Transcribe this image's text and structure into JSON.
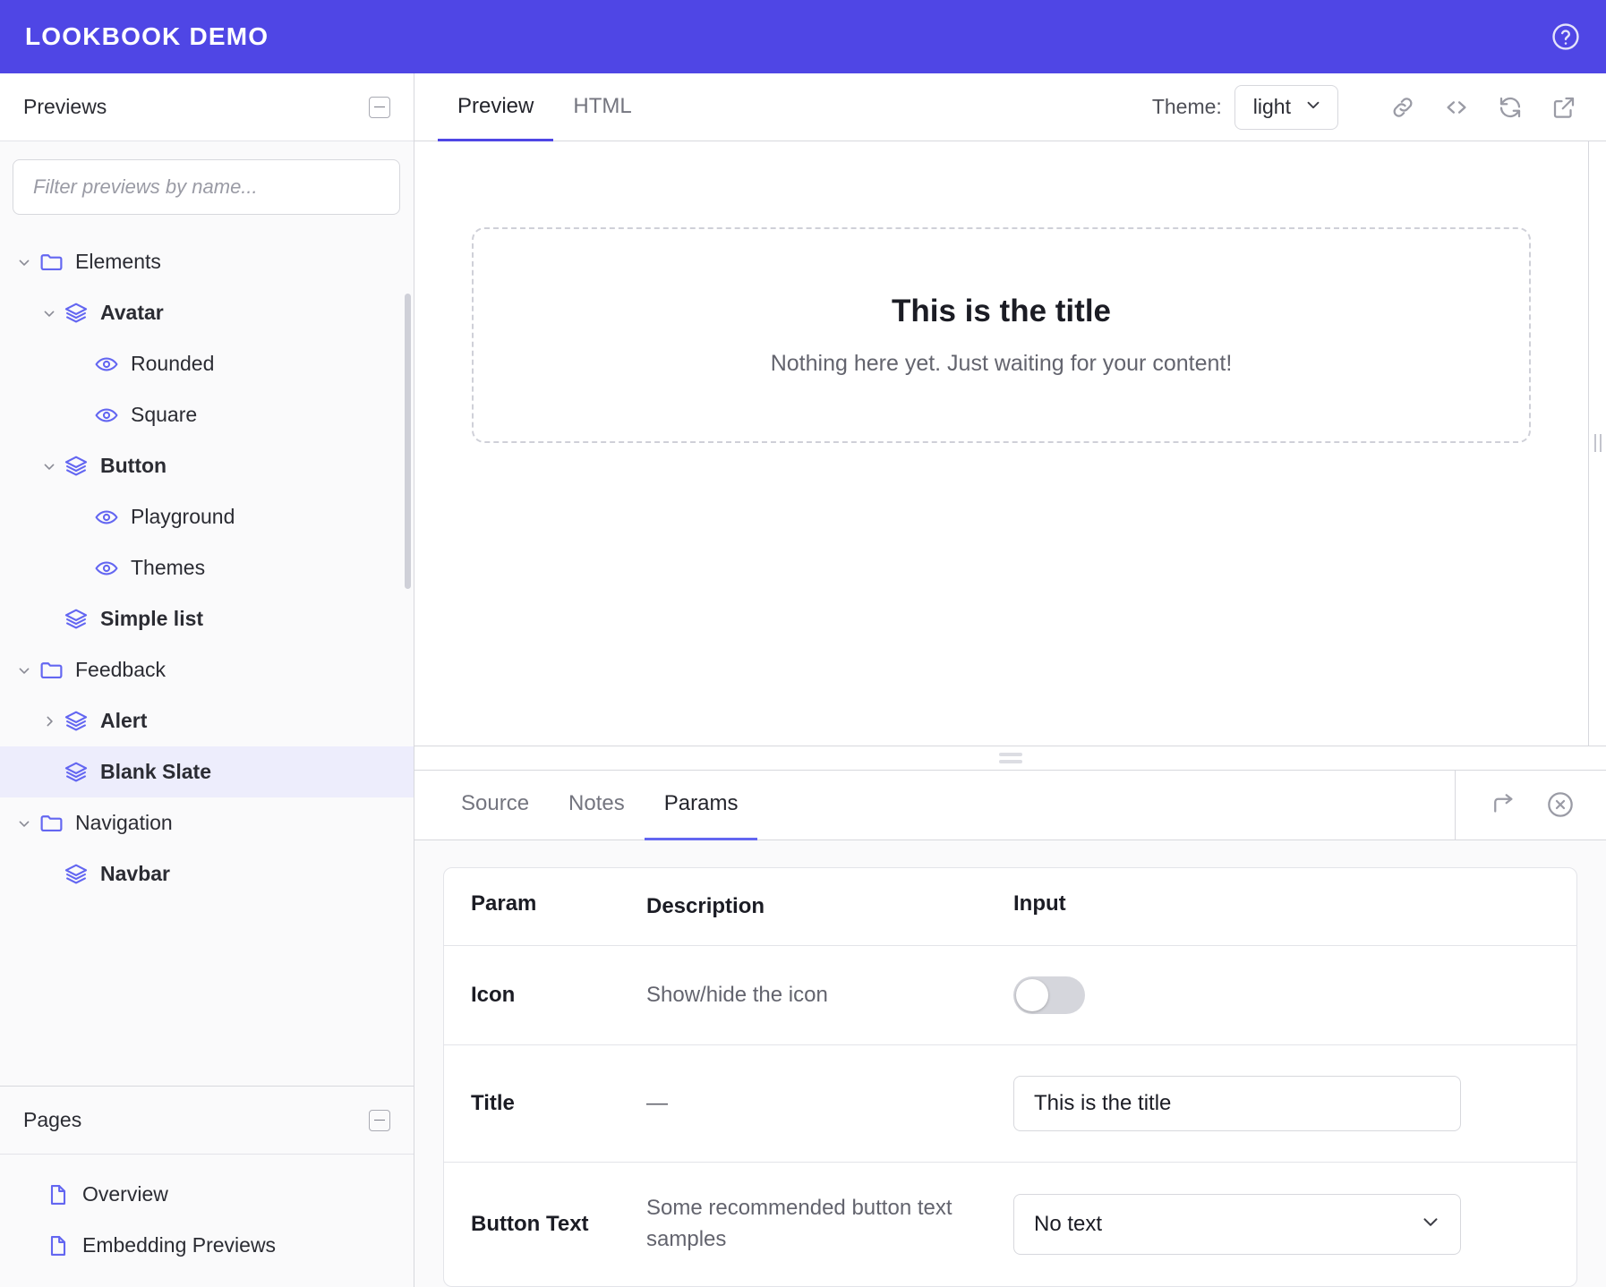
{
  "app": {
    "brand": "Lookbook Demo",
    "help_icon": "help-circle-icon",
    "accent_color": "#4F46E5",
    "selection_color": "#EDEDFC"
  },
  "sidebar": {
    "previews": {
      "title": "Previews",
      "collapse_icon": "minus-box-icon",
      "filter": {
        "placeholder": "Filter previews by name...",
        "value": ""
      },
      "tree": [
        {
          "label": "Elements",
          "icon": "folder-icon",
          "indent": 0,
          "chevron": "down",
          "bold": false,
          "selected": false
        },
        {
          "label": "Avatar",
          "icon": "layers-icon",
          "indent": 1,
          "chevron": "down",
          "bold": true,
          "selected": false
        },
        {
          "label": "Rounded",
          "icon": "eye-icon",
          "indent": 2,
          "chevron": "none",
          "bold": false,
          "selected": false
        },
        {
          "label": "Square",
          "icon": "eye-icon",
          "indent": 2,
          "chevron": "none",
          "bold": false,
          "selected": false
        },
        {
          "label": "Button",
          "icon": "layers-icon",
          "indent": 1,
          "chevron": "down",
          "bold": true,
          "selected": false
        },
        {
          "label": "Playground",
          "icon": "eye-icon",
          "indent": 2,
          "chevron": "none",
          "bold": false,
          "selected": false
        },
        {
          "label": "Themes",
          "icon": "eye-icon",
          "indent": 2,
          "chevron": "none",
          "bold": false,
          "selected": false
        },
        {
          "label": "Simple list",
          "icon": "layers-icon",
          "indent": 1,
          "chevron": "none",
          "bold": true,
          "selected": false
        },
        {
          "label": "Feedback",
          "icon": "folder-icon",
          "indent": 0,
          "chevron": "down",
          "bold": false,
          "selected": false
        },
        {
          "label": "Alert",
          "icon": "layers-icon",
          "indent": 1,
          "chevron": "right",
          "bold": true,
          "selected": false
        },
        {
          "label": "Blank Slate",
          "icon": "layers-icon",
          "indent": 1,
          "chevron": "none",
          "bold": true,
          "selected": true
        },
        {
          "label": "Navigation",
          "icon": "folder-icon",
          "indent": 0,
          "chevron": "down",
          "bold": false,
          "selected": false
        },
        {
          "label": "Navbar",
          "icon": "layers-icon",
          "indent": 1,
          "chevron": "none",
          "bold": true,
          "selected": false
        }
      ]
    },
    "pages": {
      "title": "Pages",
      "collapse_icon": "minus-box-icon",
      "items": [
        {
          "label": "Overview",
          "icon": "file-icon"
        },
        {
          "label": "Embedding Previews",
          "icon": "file-icon"
        }
      ]
    }
  },
  "main": {
    "tabs": [
      {
        "label": "Preview",
        "active": true
      },
      {
        "label": "HTML",
        "active": false
      }
    ],
    "theme": {
      "label": "Theme:",
      "value": "light",
      "chevron_icon": "chevron-down-icon"
    },
    "toolbar_icons": [
      {
        "name": "link-icon"
      },
      {
        "name": "code-icon"
      },
      {
        "name": "refresh-icon"
      },
      {
        "name": "external-link-icon"
      }
    ],
    "preview": {
      "title": "This is the title",
      "text": "Nothing here yet. Just waiting for your content!"
    },
    "vertical_resizer": "vertical-resize-handle",
    "horizontal_resizer": "horizontal-resize-handle"
  },
  "inspector": {
    "tabs": [
      {
        "label": "Source",
        "active": false
      },
      {
        "label": "Notes",
        "active": false
      },
      {
        "label": "Params",
        "active": true
      }
    ],
    "actions": [
      {
        "name": "open-in-new-icon"
      },
      {
        "name": "close-circle-icon"
      }
    ],
    "params_table": {
      "columns": [
        "Param",
        "Description",
        "Input"
      ],
      "rows": [
        {
          "param": "Icon",
          "description": "Show/hide the icon",
          "input_type": "toggle",
          "value": "off"
        },
        {
          "param": "Title",
          "description": "—",
          "input_type": "text",
          "value": "This is the title"
        },
        {
          "param": "Button Text",
          "description": "Some recommended button text samples",
          "input_type": "select",
          "value": "No text"
        }
      ]
    }
  }
}
